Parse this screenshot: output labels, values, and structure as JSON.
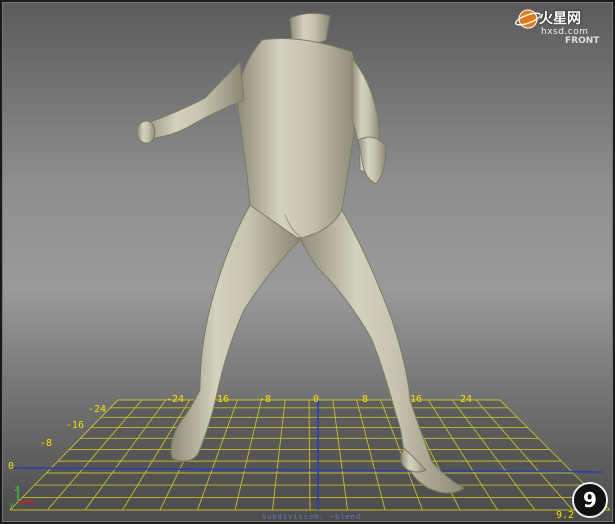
{
  "watermark": {
    "site_name": "火星网",
    "site_url": "hxsd.com"
  },
  "viewcube": {
    "label": "FRONT"
  },
  "grid": {
    "top_labels": [
      "-24",
      "-16",
      "-8",
      "0",
      "8",
      "16",
      "24"
    ],
    "left_labels": [
      "-24",
      "-16",
      "-8",
      "0"
    ]
  },
  "axis_gizmo": {
    "x_label": "x",
    "y_label": "y",
    "z_label": "z"
  },
  "status_text": "Subdivision: ~blend",
  "badge": "9",
  "readout": "9.2",
  "colors": {
    "grid_line": "#d8cf2a",
    "axis_line": "#2a3fb0",
    "label": "#f2e000",
    "model": "#c9c7b2"
  }
}
